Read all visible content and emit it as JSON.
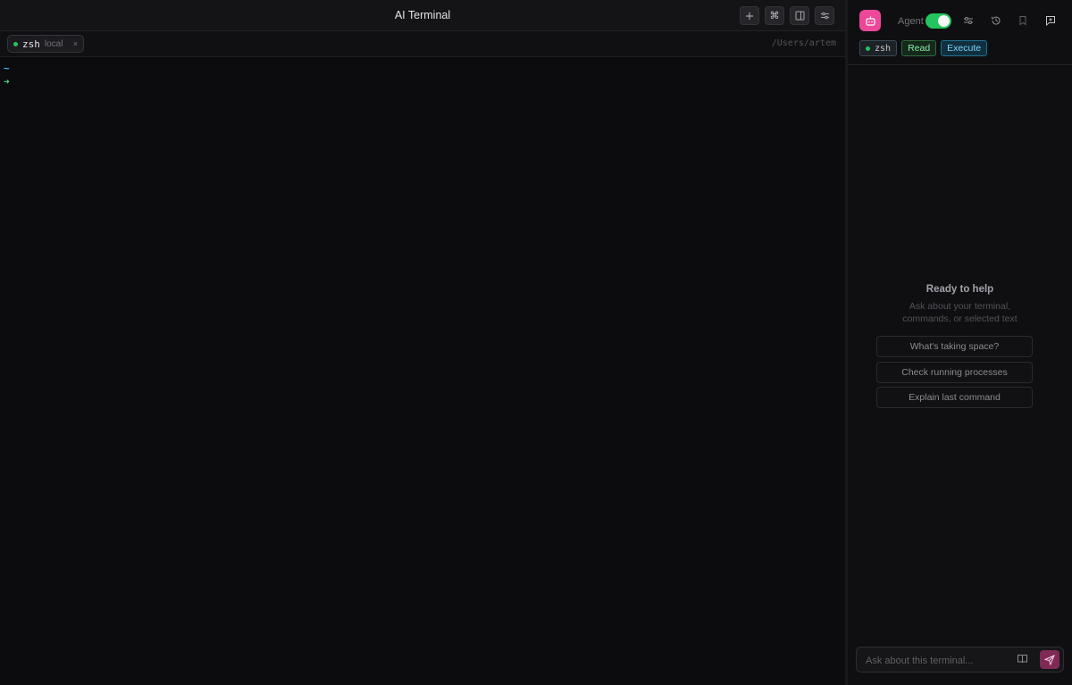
{
  "window": {
    "title": "AI Terminal"
  },
  "toolbar": {
    "buttons": [
      {
        "icon": "plus-icon"
      },
      {
        "icon": "command-icon"
      },
      {
        "icon": "sidebar-icon"
      },
      {
        "icon": "sliders-icon"
      }
    ]
  },
  "tab": {
    "shell": "zsh",
    "host": "local",
    "close": "×",
    "status_color": "#22c55e"
  },
  "cwd": "/Users/artem",
  "terminal": {
    "lines": [
      "~",
      "➜"
    ]
  },
  "panel": {
    "agent_label": "Agent",
    "agent_enabled": true,
    "accent": "#ec4899",
    "chips": {
      "shell": "zsh",
      "read": "Read",
      "execute": "Execute"
    },
    "empty_title": "Ready to help",
    "empty_desc": "Ask about your terminal, commands, or selected text",
    "suggestions": [
      "What's taking space?",
      "Check running processes",
      "Explain last command"
    ],
    "input_placeholder": "Ask about this terminal..."
  }
}
